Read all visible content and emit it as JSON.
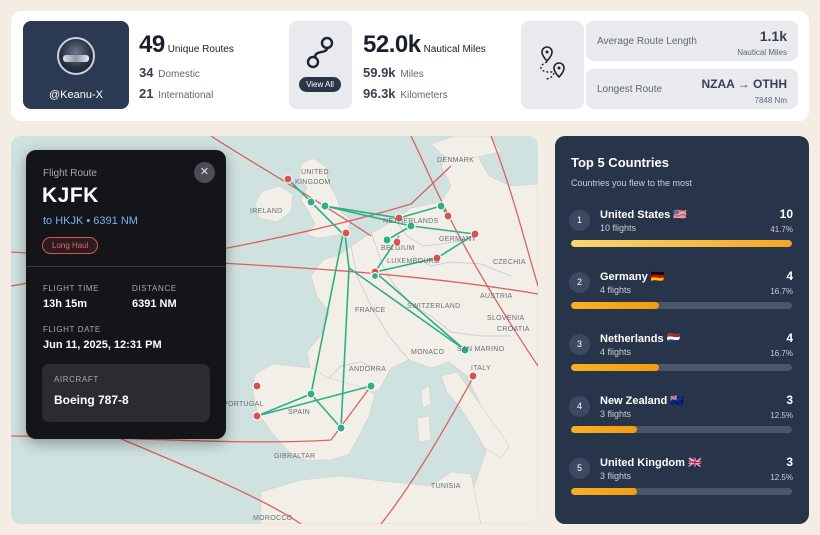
{
  "profile": {
    "handle": "@Keanu-X"
  },
  "routes": {
    "count": "49",
    "count_label": "Unique Routes",
    "domestic_value": "34",
    "domestic_label": "Domestic",
    "international_value": "21",
    "international_label": "International"
  },
  "distance": {
    "value": "52.0k",
    "label": "Nautical Miles",
    "miles_value": "59.9k",
    "miles_label": "Miles",
    "km_value": "96.3k",
    "km_label": "Kilometers",
    "view_all_label": "View All"
  },
  "average_route": {
    "label": "Average Route Length",
    "value": "1.1k",
    "unit": "Nautical Miles"
  },
  "longest_route": {
    "label": "Longest Route",
    "value": "NZAA → OTHH",
    "distance": "7848 Nm"
  },
  "map_labels": {
    "denmark": "DENMARK",
    "united": "UNITED",
    "kingdom": "KINGDOM",
    "ireland": "IRELAND",
    "netherlands": "NETHERLANDS",
    "belgium": "BELGIUM",
    "germany": "GERMANY",
    "luxembourg": "LUXEMBOURG",
    "czechia": "CZECHIA",
    "france": "FRANCE",
    "switzerland": "SWITZERLAND",
    "austria": "AUSTRIA",
    "slovenia": "SLOVENIA",
    "croatia": "CROATIA",
    "monaco": "MONACO",
    "san_marino": "SAN MARINO",
    "andorra": "ANDORRA",
    "italy": "ITALY",
    "portugal": "PORTUGAL",
    "spain": "SPAIN",
    "gibraltar": "GIBRALTAR",
    "tunisia": "TUNISIA",
    "morocco": "MOROCCO"
  },
  "flight_panel": {
    "label": "Flight Route",
    "code": "KJFK",
    "destination": "to HKJK • 6391 NM",
    "badge": "Long Haul",
    "close_glyph": "✕",
    "flight_time_label": "FLIGHT TIME",
    "flight_time_value": "13h 15m",
    "distance_label": "DISTANCE",
    "distance_value": "6391 NM",
    "flight_date_label": "FLIGHT DATE",
    "flight_date_value": "Jun 11, 2025, 12:31 PM",
    "aircraft_label": "AIRCRAFT",
    "aircraft_value": "Boeing 787-8"
  },
  "top_countries": {
    "title": "Top 5 Countries",
    "subtitle": "Countries you flew to the most",
    "items": [
      {
        "rank": "1",
        "name": "United States",
        "flag": "🇺🇸",
        "flights": "10 flights",
        "count": "10",
        "pct": "41.7%",
        "fraction": 1.0
      },
      {
        "rank": "2",
        "name": "Germany",
        "flag": "🇩🇪",
        "flights": "4 flights",
        "count": "4",
        "pct": "16.7%",
        "fraction": 0.4
      },
      {
        "rank": "3",
        "name": "Netherlands",
        "flag": "🇳🇱",
        "flights": "4 flights",
        "count": "4",
        "pct": "16.7%",
        "fraction": 0.4
      },
      {
        "rank": "4",
        "name": "New Zealand",
        "flag": "🇳🇿",
        "flights": "3 flights",
        "count": "3",
        "pct": "12.5%",
        "fraction": 0.3
      },
      {
        "rank": "5",
        "name": "United Kingdom",
        "flag": "🇬🇧",
        "flights": "3 flights",
        "count": "3",
        "pct": "12.5%",
        "fraction": 0.3
      }
    ]
  },
  "colors": {
    "accent_orange": "#f5a623",
    "route_green": "#2fae84",
    "route_red": "#d9534f",
    "panel_dark": "#141518",
    "card_navy": "#28344a"
  }
}
